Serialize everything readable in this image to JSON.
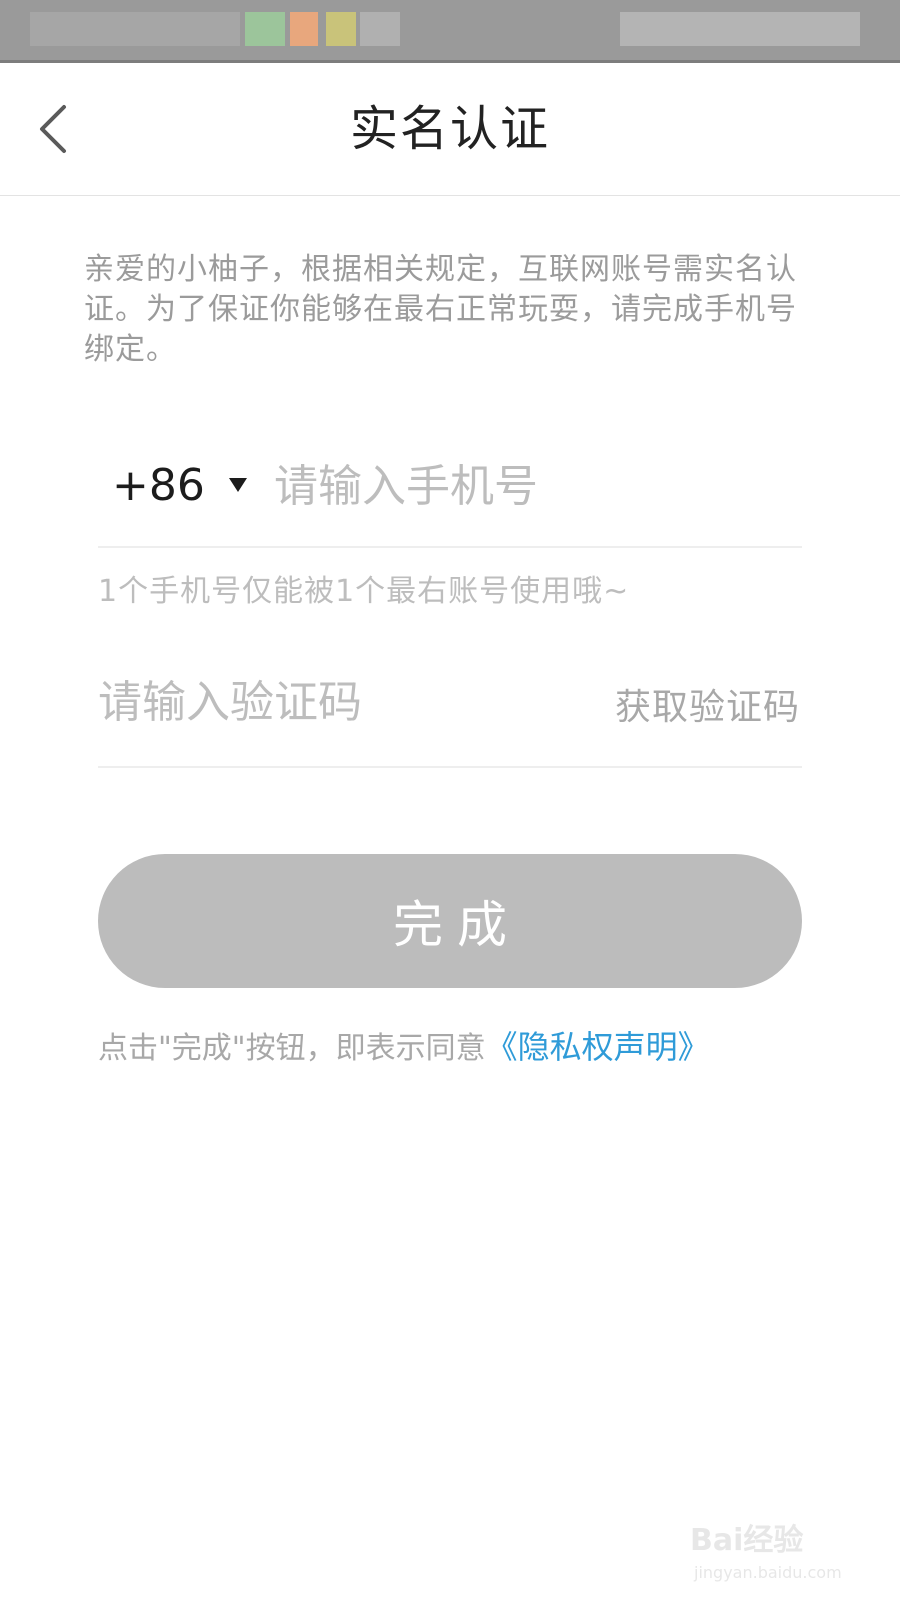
{
  "nav": {
    "title": "实名认证",
    "back_icon": "chevron-left-icon"
  },
  "intro": "亲爱的小柚子，根据相关规定，互联网账号需实名认证。为了保证你能够在最右正常玩耍，请完成手机号绑定。",
  "phone": {
    "country_code": "+86",
    "placeholder": "请输入手机号",
    "value": "",
    "hint": "1个手机号仅能被1个最右账号使用哦~"
  },
  "verification": {
    "placeholder": "请输入验证码",
    "value": "",
    "get_code_label": "获取验证码"
  },
  "submit": {
    "label": "完成"
  },
  "agreement": {
    "prefix": "点击\"完成\"按钮，即表示同意",
    "link_label": "《隐私权声明》"
  },
  "watermark": {
    "text": "Bai经验",
    "sub": "jingyan.baidu.com"
  },
  "colors": {
    "link": "#2f9bd8",
    "button_disabled": "#bcbcbc",
    "placeholder": "#bdbdbd",
    "title": "#222222"
  }
}
